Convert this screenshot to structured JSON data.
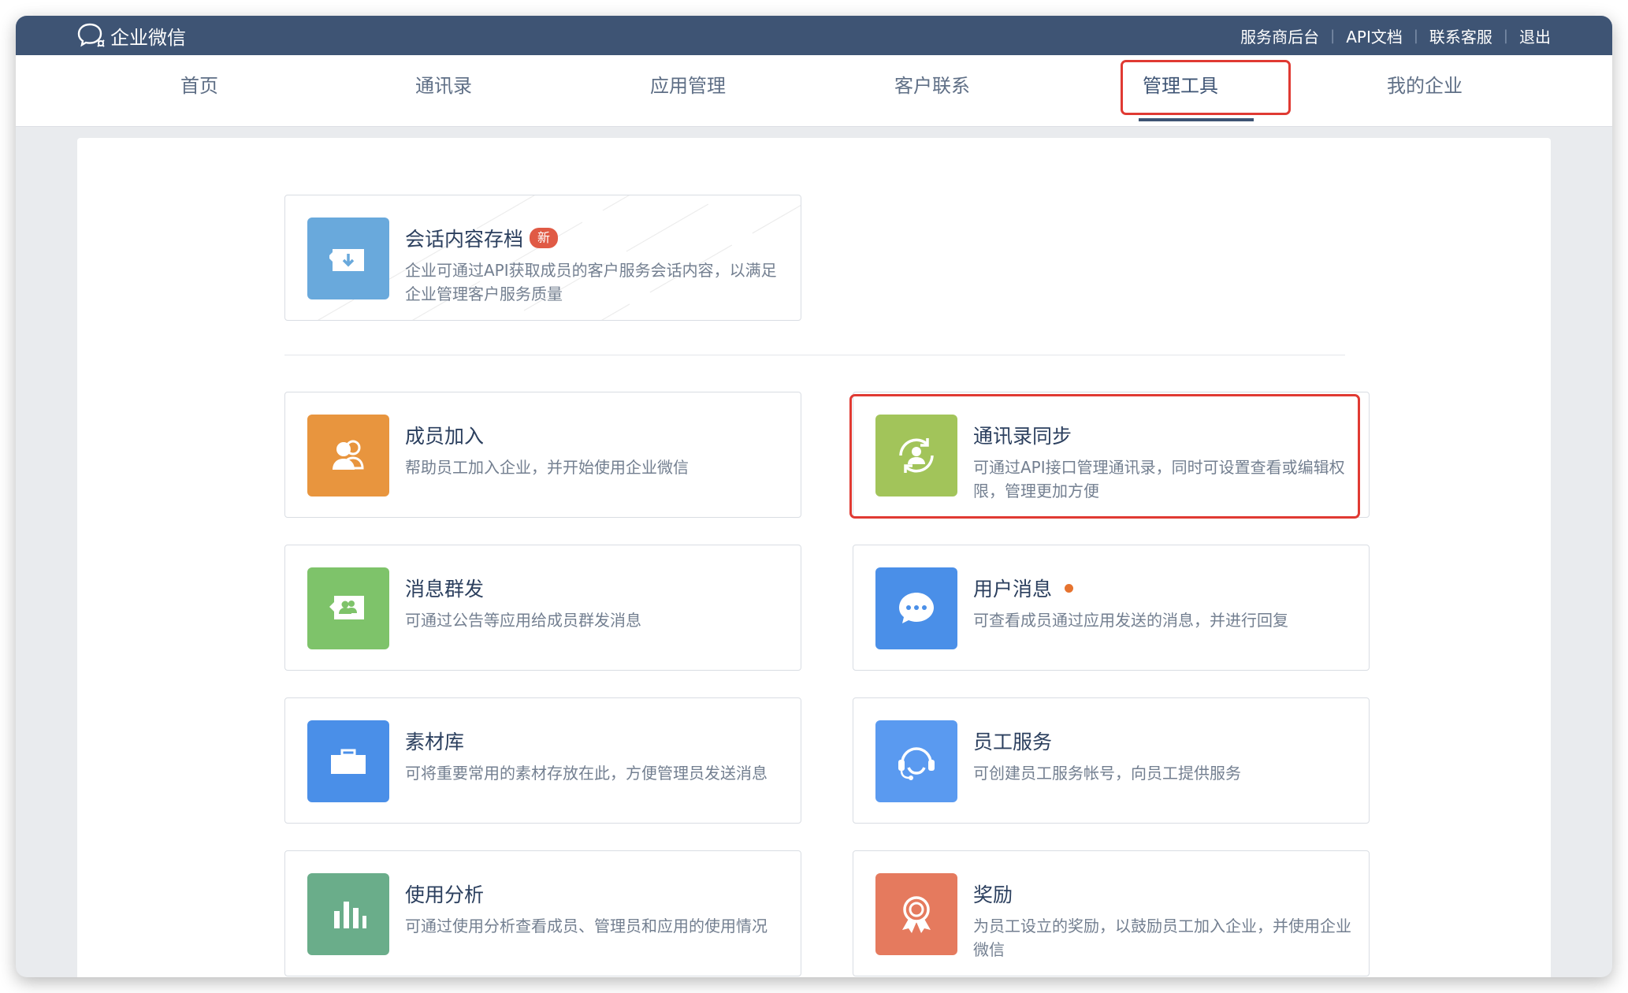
{
  "header": {
    "logo_text": "企业微信",
    "links": [
      "服务商后台",
      "API文档",
      "联系客服",
      "退出"
    ],
    "separator": "|"
  },
  "nav": {
    "items": [
      "首页",
      "通讯录",
      "应用管理",
      "客户联系",
      "管理工具",
      "我的企业"
    ],
    "active": "管理工具"
  },
  "cards": {
    "archive": {
      "title": "会话内容存档",
      "badge": "新",
      "desc": "企业可通过API获取成员的客户服务会话内容，以满足企业管理客户服务质量",
      "color": "#69a9dc",
      "icon": "archive-download-icon"
    },
    "member_join": {
      "title": "成员加入",
      "desc": "帮助员工加入企业，并开始使用企业微信",
      "color": "#e8953e",
      "icon": "users-icon"
    },
    "contact_sync": {
      "title": "通讯录同步",
      "desc": "可通过API接口管理通讯录，同时可设置查看或编辑权限，管理更加方便",
      "color": "#a2c45a",
      "icon": "user-sync-icon"
    },
    "broadcast": {
      "title": "消息群发",
      "desc": "可通过公告等应用给成员群发消息",
      "color": "#7ec36a",
      "icon": "broadcast-icon"
    },
    "user_messages": {
      "title": "用户消息",
      "desc": "可查看成员通过应用发送的消息，并进行回复",
      "color": "#4a8fe8",
      "icon": "chat-bubble-icon"
    },
    "materials": {
      "title": "素材库",
      "desc": "可将重要常用的素材存放在此，方便管理员发送消息",
      "color": "#4a8fe8",
      "icon": "briefcase-icon"
    },
    "staff_service": {
      "title": "员工服务",
      "desc": "可创建员工服务帐号，向员工提供服务",
      "color": "#5a9af0",
      "icon": "headset-icon"
    },
    "analytics": {
      "title": "使用分析",
      "desc": "可通过使用分析查看成员、管理员和应用的使用情况",
      "color": "#6aad8a",
      "icon": "bar-chart-icon"
    },
    "rewards": {
      "title": "奖励",
      "desc": "为员工设立的奖励，以鼓励员工加入企业，并使用企业微信",
      "color": "#e57a5e",
      "icon": "award-medal-icon"
    }
  }
}
